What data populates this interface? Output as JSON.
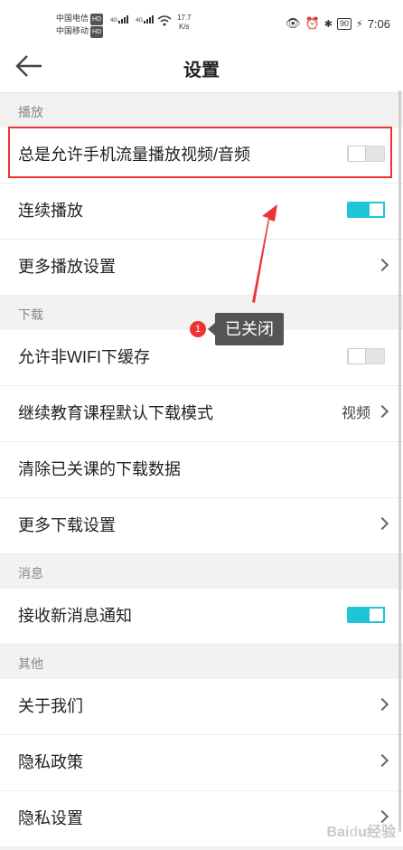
{
  "status_bar": {
    "carrier1": "中国电信",
    "carrier2": "中国移动",
    "hd": "HD",
    "signal_label": "4G",
    "net_speed_value": "17.7",
    "net_speed_unit": "K/s",
    "battery": "90",
    "time": "7:06"
  },
  "header": {
    "title": "设置"
  },
  "sections": {
    "playback": {
      "title": "播放",
      "items": [
        {
          "label": "总是允许手机流量播放视频/音频",
          "toggle": "off"
        },
        {
          "label": "连续播放",
          "toggle": "on"
        },
        {
          "label": "更多播放设置",
          "chevron": true
        }
      ]
    },
    "download": {
      "title": "下载",
      "items": [
        {
          "label": "允许非WIFI下缓存",
          "toggle": "off"
        },
        {
          "label": "继续教育课程默认下载模式",
          "value": "视频",
          "chevron": true
        },
        {
          "label": "清除已关课的下载数据"
        },
        {
          "label": "更多下载设置",
          "chevron": true
        }
      ]
    },
    "messages": {
      "title": "消息",
      "items": [
        {
          "label": "接收新消息通知",
          "toggle": "on"
        }
      ]
    },
    "other": {
      "title": "其他",
      "items": [
        {
          "label": "关于我们",
          "chevron": true
        },
        {
          "label": "隐私政策",
          "chevron": true
        },
        {
          "label": "隐私设置",
          "chevron": true
        }
      ]
    }
  },
  "annotation": {
    "badge": "1",
    "tooltip": "已关闭"
  },
  "watermark": "Baidu经验",
  "colors": {
    "accent": "#1ec5d8",
    "highlight": "#ee3333"
  }
}
